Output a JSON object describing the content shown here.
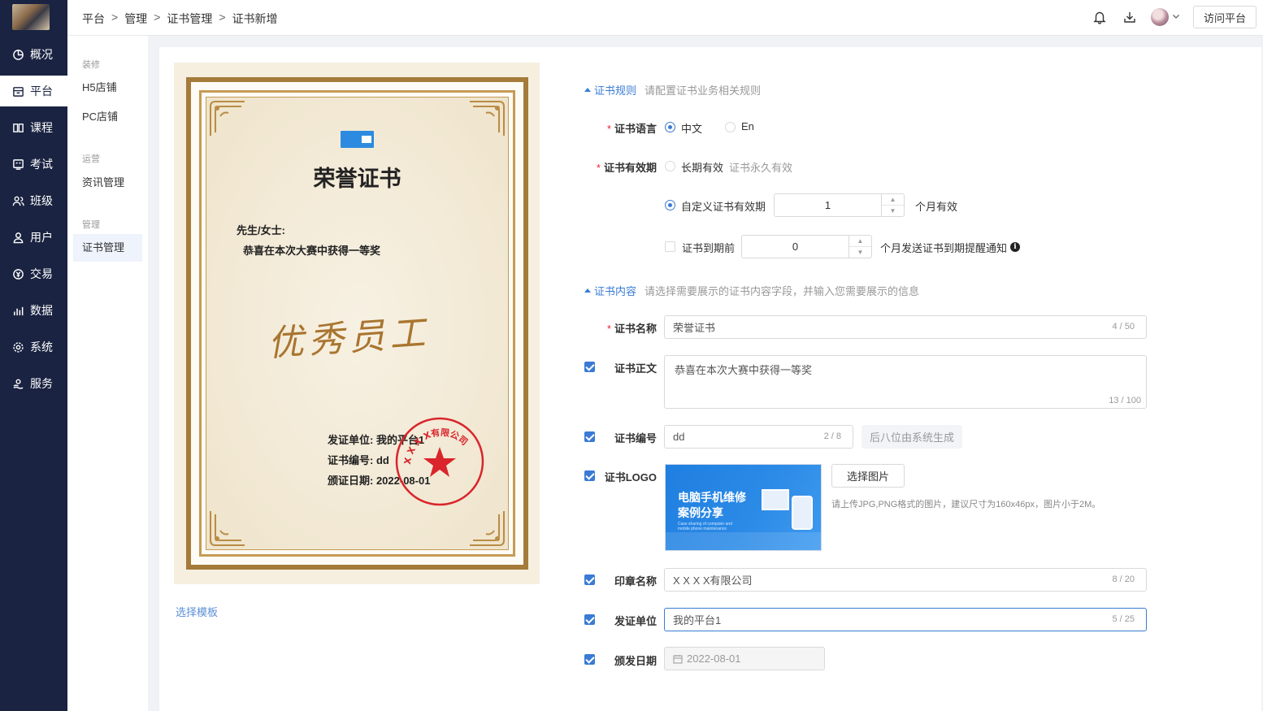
{
  "nav": {
    "items": [
      {
        "label": "概况",
        "icon": "pie-chart-icon"
      },
      {
        "label": "平台",
        "icon": "store-icon"
      },
      {
        "label": "课程",
        "icon": "book-icon"
      },
      {
        "label": "考试",
        "icon": "exam-icon"
      },
      {
        "label": "班级",
        "icon": "group-icon"
      },
      {
        "label": "用户",
        "icon": "user-icon"
      },
      {
        "label": "交易",
        "icon": "currency-icon"
      },
      {
        "label": "数据",
        "icon": "bar-chart-icon"
      },
      {
        "label": "系统",
        "icon": "gear-icon"
      },
      {
        "label": "服务",
        "icon": "service-icon"
      }
    ],
    "active": "平台"
  },
  "submenu": {
    "groups": [
      {
        "title": "装修",
        "links": [
          "H5店铺",
          "PC店铺"
        ]
      },
      {
        "title": "运营",
        "links": [
          "资讯管理"
        ]
      },
      {
        "title": "管理",
        "links": [
          "证书管理"
        ]
      }
    ],
    "active": "证书管理"
  },
  "header": {
    "breadcrumb": [
      "平台",
      "管理",
      "证书管理",
      "证书新增"
    ],
    "visit_button": "访问平台"
  },
  "certificate_preview": {
    "title": "荣誉证书",
    "greeting": "先生/女士:",
    "body": "恭喜在本次大赛中获得一等奖",
    "signature": "优秀员工",
    "issuer_line": "发证单位: 我的平台1",
    "number_line": "证书编号: dd",
    "date_line": "颁证日期: 2022-08-01",
    "seal_text": "X X X X有限公司",
    "seal_color": "#d9252b",
    "frame_color": "#a47b3b"
  },
  "template_link": "选择模板",
  "rules": {
    "section_title": "证书规则",
    "section_desc": "请配置证书业务相关规则",
    "language": {
      "label": "证书语言",
      "options": [
        "中文",
        "En"
      ],
      "selected": "中文"
    },
    "validity": {
      "label": "证书有效期",
      "long_term": "长期有效",
      "long_term_desc": "证书永久有效",
      "custom": "自定义证书有效期",
      "custom_selected": true,
      "months_value": "1",
      "months_suffix": "个月有效"
    },
    "reminder": {
      "label": "证书到期前",
      "checked": false,
      "value": "0",
      "suffix": "个月发送证书到期提醒通知"
    }
  },
  "content": {
    "section_title": "证书内容",
    "section_desc": "请选择需要展示的证书内容字段，并输入您需要展示的信息",
    "name": {
      "label": "证书名称",
      "value": "荣誉证书",
      "count": "4 / 50"
    },
    "body": {
      "label": "证书正文",
      "checked": true,
      "value": "恭喜在本次大赛中获得一等奖",
      "count": "13 / 100"
    },
    "number": {
      "label": "证书编号",
      "checked": true,
      "value": "dd",
      "count": "2 / 8",
      "suffix_button": "后八位由系统生成"
    },
    "logo": {
      "label": "证书LOGO",
      "checked": true,
      "choose_button": "选择图片",
      "hint": "请上传JPG,PNG格式的图片，建议尺寸为160x46px，图片小于2M。",
      "image_title_1": "电脑手机维修",
      "image_title_2": "案例分享",
      "image_subtitle": "Case sharing of computer and mobile phone maintenance"
    },
    "seal": {
      "label": "印章名称",
      "checked": true,
      "value": "X X X X有限公司",
      "count": "8 / 20"
    },
    "issuer": {
      "label": "发证单位",
      "checked": true,
      "value": "我的平台1",
      "count": "5 / 25"
    },
    "date": {
      "label": "颁发日期",
      "checked": true,
      "value": "2022-08-01"
    }
  },
  "colors": {
    "accent": "#3a7bd5",
    "sidebar": "#1a2341",
    "required": "#f5222d"
  }
}
